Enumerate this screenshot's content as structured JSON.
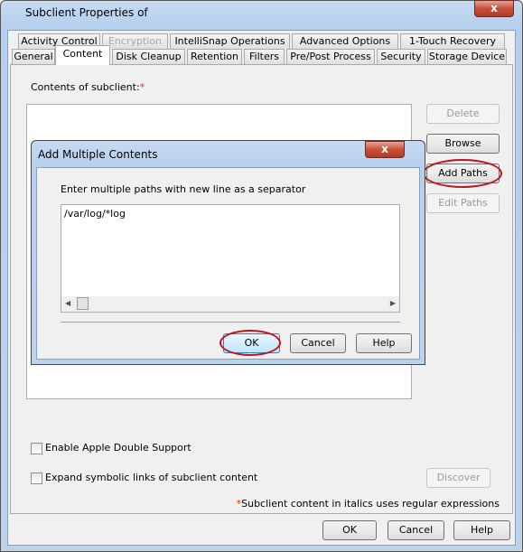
{
  "window": {
    "title": "Subclient Properties of",
    "close_label": "x"
  },
  "tabs_row1": [
    {
      "label": "Activity Control",
      "disabled": false
    },
    {
      "label": "Encryption",
      "disabled": true
    },
    {
      "label": "IntelliSnap Operations",
      "disabled": false
    },
    {
      "label": "Advanced Options",
      "disabled": false
    },
    {
      "label": "1-Touch Recovery",
      "disabled": false
    }
  ],
  "tabs_row2": [
    {
      "label": "General"
    },
    {
      "label": "Content",
      "selected": true
    },
    {
      "label": "Disk Cleanup"
    },
    {
      "label": "Retention"
    },
    {
      "label": "Filters"
    },
    {
      "label": "Pre/Post Process"
    },
    {
      "label": "Security"
    },
    {
      "label": "Storage Device"
    }
  ],
  "content": {
    "label": "Contents of subclient:",
    "required_mark": "*",
    "buttons": {
      "delete": "Delete",
      "browse": "Browse",
      "add_paths": "Add Paths",
      "edit_paths": "Edit Paths",
      "discover": "Discover"
    },
    "checkboxes": [
      {
        "label": "Enable Apple Double Support",
        "checked": false
      },
      {
        "label": "Expand symbolic links of subclient content",
        "checked": false
      }
    ],
    "note_mark": "*",
    "note": "Subclient content in italics uses regular expressions"
  },
  "dialog": {
    "title": "Add Multiple Contents",
    "close_label": "x",
    "instruction": "Enter multiple paths with new line as a separator",
    "paths_value": "/var/log/*log",
    "ok": "OK",
    "cancel": "Cancel",
    "help": "Help"
  },
  "footer": {
    "ok": "OK",
    "cancel": "Cancel",
    "help": "Help"
  },
  "colors": {
    "highlight_ring": "#c0141c",
    "required": "#e03020"
  }
}
